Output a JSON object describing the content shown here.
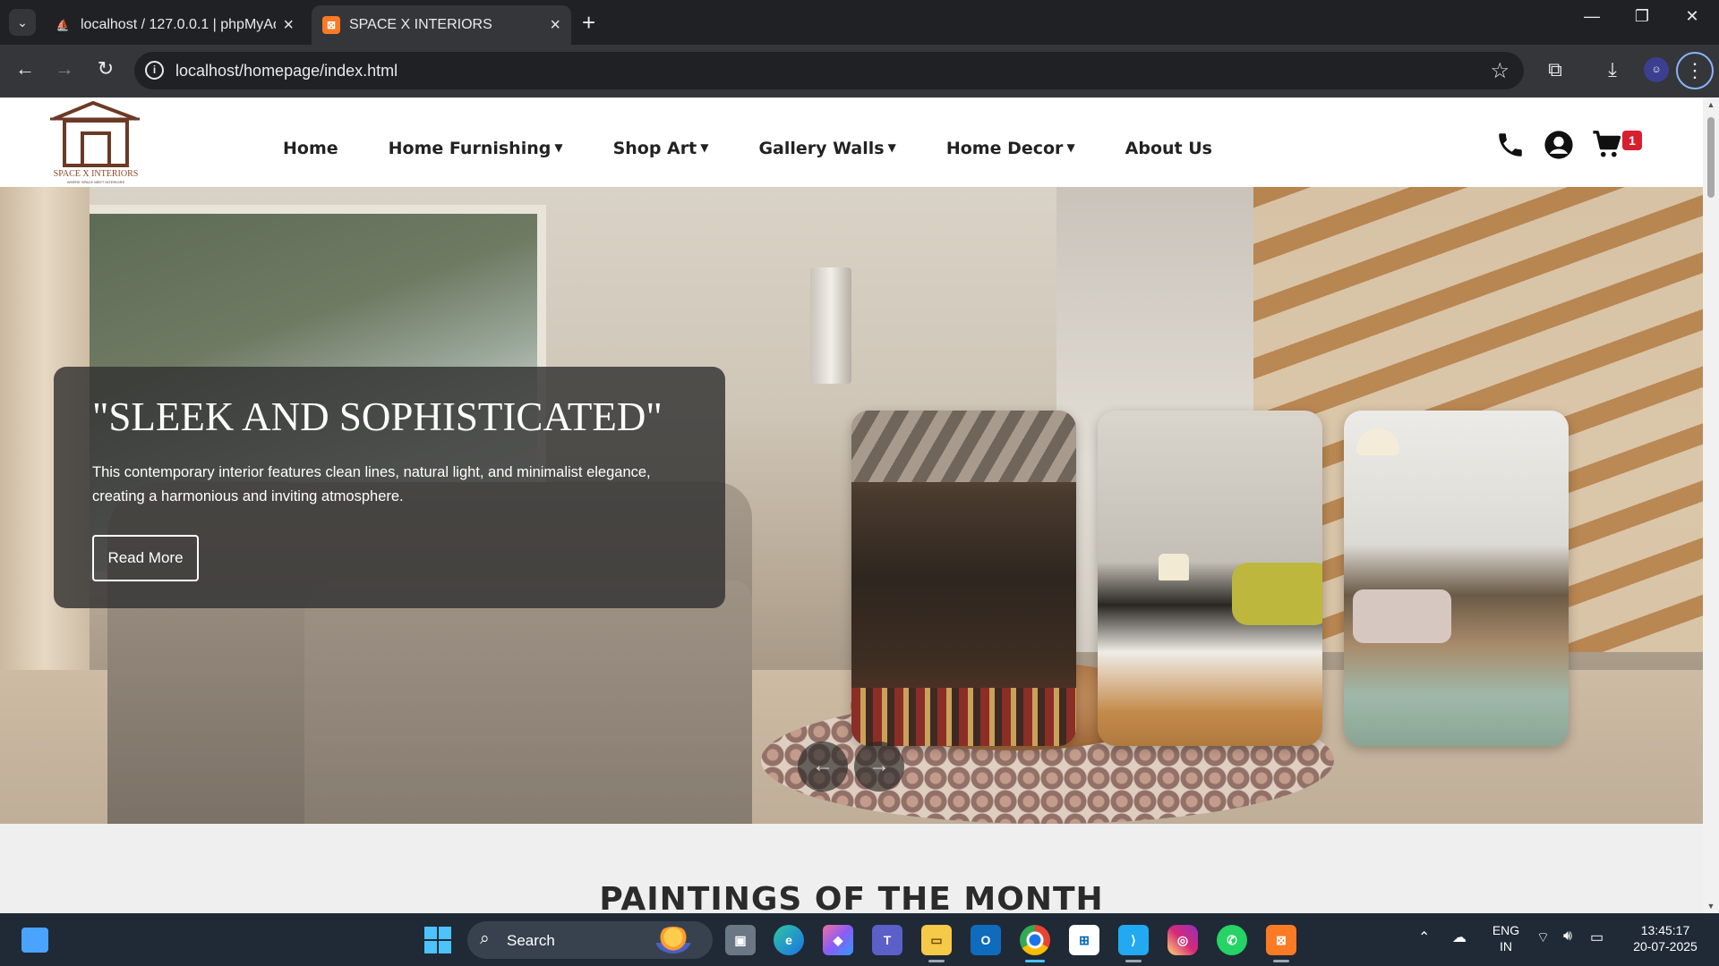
{
  "browser": {
    "tabs": [
      {
        "title": "localhost / 127.0.0.1 | phpMyAdmin",
        "favicon": "phpmyadmin-icon",
        "active": false
      },
      {
        "title": "SPACE X INTERIORS",
        "favicon": "xampp-icon",
        "active": true
      }
    ],
    "url": "localhost/homepage/index.html"
  },
  "site": {
    "logo_text": "SPACE X INTERIORS",
    "logo_tagline": "WHERE SPACE MEET INTERIORS",
    "nav": [
      {
        "label": "Home",
        "dropdown": false
      },
      {
        "label": "Home Furnishing",
        "dropdown": true
      },
      {
        "label": "Shop Art",
        "dropdown": true
      },
      {
        "label": "Gallery Walls",
        "dropdown": true
      },
      {
        "label": "Home Decor",
        "dropdown": true
      },
      {
        "label": "About Us",
        "dropdown": false
      }
    ],
    "cart_count": "1",
    "colors": {
      "cart_badge": "#d6202f",
      "caption_bg": "#323232"
    }
  },
  "hero": {
    "heading": "\"SLEEK AND SOPHISTICATED\"",
    "description": "This contemporary interior features clean lines, natural light, and minimalist elegance, creating a harmonious and inviting atmosphere.",
    "button": "Read More",
    "prev_glyph": "←",
    "next_glyph": "→"
  },
  "section": {
    "title": "PAINTINGS OF THE MONTH"
  },
  "taskbar": {
    "search_label": "Search",
    "language": "ENG",
    "region": "IN",
    "time": "13:45:17",
    "date": "20-07-2025"
  }
}
